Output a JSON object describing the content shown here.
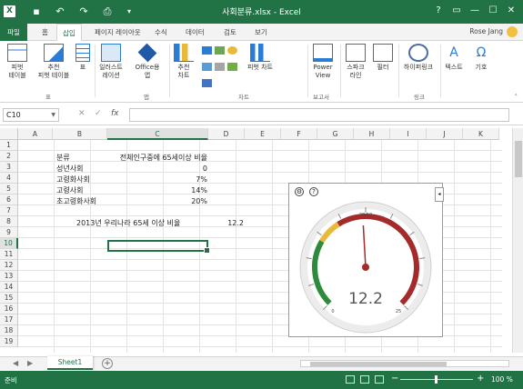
{
  "window": {
    "title": "사회분류.xlsx - Excel",
    "buttons": [
      "?",
      "▭",
      "—",
      "☐",
      "✕"
    ]
  },
  "quick_access": [
    "save-icon",
    "undo-icon",
    "redo-icon",
    "print-preview-icon",
    "customize-icon"
  ],
  "tabs": {
    "file": "파일",
    "items": [
      "홈",
      "삽입",
      "페이지 레이아웃",
      "수식",
      "데이터",
      "검토",
      "보기"
    ],
    "active": "삽입"
  },
  "user": "Rose Jang",
  "ribbon": {
    "buttons": {
      "pivot_table": "피벗\n테이블",
      "recommended_pivot": "추천\n피벗 테이블",
      "table": "표",
      "illustrations": "일러스트\n레이션",
      "office_apps": "Office용\n앱",
      "recommended_charts": "추천\n차트",
      "pivot_chart": "피벗 차트",
      "power_view": "Power\nView",
      "sparklines": "스파크\n라인",
      "filters": "필터",
      "hyperlink": "하이퍼링크",
      "text": "텍스트",
      "symbols": "기호"
    },
    "groups": {
      "tables": "표",
      "apps": "앱",
      "charts": "차트",
      "reports": "보고서",
      "links": "링크"
    }
  },
  "formula_bar": {
    "name_box": "C10",
    "cancel": "✕",
    "enter": "✓",
    "fx": "fx",
    "content": ""
  },
  "columns": [
    "A",
    "B",
    "C",
    "D",
    "E",
    "F",
    "G",
    "H",
    "I",
    "J",
    "K"
  ],
  "rows": [
    "1",
    "2",
    "3",
    "4",
    "5",
    "6",
    "7",
    "8",
    "9",
    "10",
    "11",
    "12",
    "13",
    "14",
    "15",
    "16",
    "17",
    "18",
    "19"
  ],
  "selected": {
    "column": "C",
    "row": "10"
  },
  "sheet": {
    "header_label": "분류",
    "header_value": "전체인구중에 65세이상 비율",
    "rows": [
      {
        "label": "성년사회",
        "value": "0"
      },
      {
        "label": "고령화사회",
        "value": "7%"
      },
      {
        "label": "고령사회",
        "value": "14%"
      },
      {
        "label": "초고령화사회",
        "value": "20%"
      }
    ],
    "b8": "2013년 우리나라 65세 이상 비율",
    "d8": "12.2"
  },
  "gauge": {
    "value": "12.2",
    "min_label": "0",
    "max_label": "25",
    "top_label": "28.50",
    "needle_value": 12.2,
    "range_max": 25,
    "band_colors": [
      "#2e8b3e",
      "#e8b93a",
      "#a52a2a"
    ],
    "icons": [
      "settings-icon",
      "help-icon"
    ],
    "expand": "◂"
  },
  "sheet_tabs": {
    "nav_prev": "◀",
    "nav_next": "▶",
    "active": "Sheet1",
    "add": "+"
  },
  "status": {
    "ready": "준비",
    "zoom_minus": "−",
    "zoom_plus": "+",
    "zoom": "100 %"
  }
}
